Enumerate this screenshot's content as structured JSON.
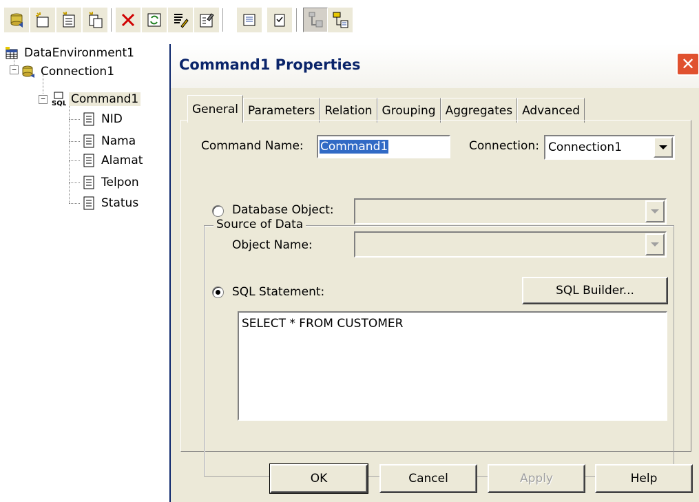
{
  "toolbar": {
    "buttons": [
      {
        "icon": "add-connection-icon"
      },
      {
        "icon": "add-command-icon"
      },
      {
        "icon": "insert-stored-procedures-icon"
      },
      {
        "icon": "add-child-command-icon"
      },
      {
        "icon": "delete-icon"
      },
      {
        "icon": "refresh-icon"
      },
      {
        "icon": "design-icon"
      },
      {
        "icon": "properties-icon"
      },
      {
        "icon": "view-code-icon"
      },
      {
        "icon": "options-icon"
      },
      {
        "icon": "arrange-by-connection-icon",
        "pressed": true
      },
      {
        "icon": "arrange-by-object-icon"
      }
    ]
  },
  "tree": {
    "root": "DataEnvironment1",
    "connection": "Connection1",
    "command": "Command1",
    "fields": [
      "NID",
      "Nama",
      "Alamat",
      "Telpon",
      "Status"
    ]
  },
  "dialog": {
    "title": "Command1 Properties",
    "close": "✕",
    "tabs": [
      "General",
      "Parameters",
      "Relation",
      "Grouping",
      "Aggregates",
      "Advanced"
    ],
    "active_tab": "General",
    "command_name_label": "Command Name:",
    "command_name_value": "Command1",
    "connection_label": "Connection:",
    "connection_value": "Connection1",
    "source_group": "Source of Data",
    "database_object_label": "Database Object:",
    "object_name_label": "Object Name:",
    "sql_statement_label": "SQL Statement:",
    "sql_builder_label": "SQL Builder...",
    "sql_text": "SELECT * FROM CUSTOMER",
    "selected_source": "sql",
    "buttons": {
      "ok": "OK",
      "cancel": "Cancel",
      "apply": "Apply",
      "help": "Help"
    }
  },
  "colors": {
    "title_text": "#0a246a",
    "selection": "#316ac5",
    "close_button": "#e0512f",
    "dialog_face": "#ece9d8"
  }
}
